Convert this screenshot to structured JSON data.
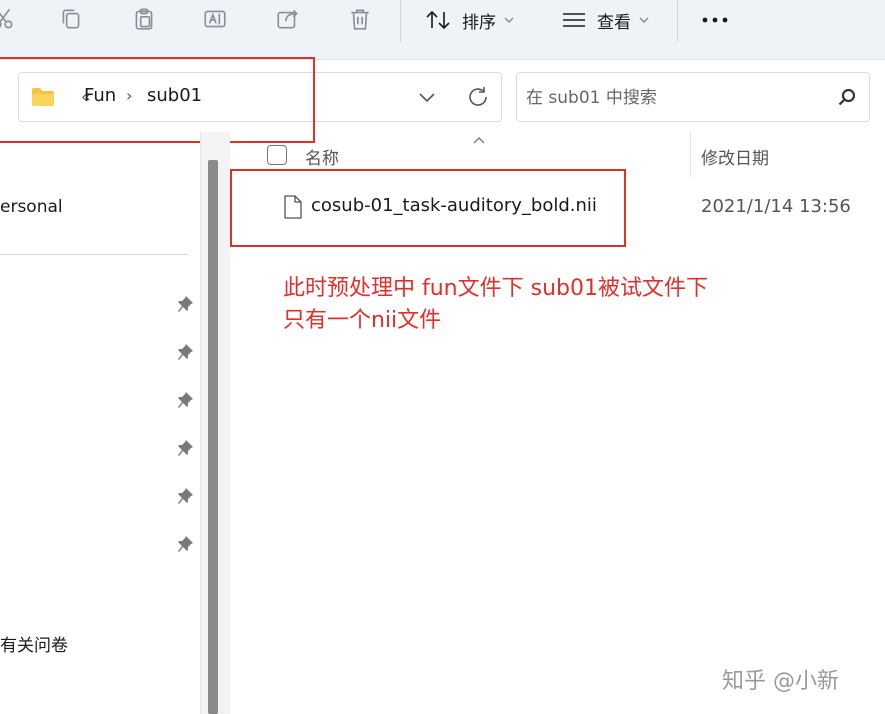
{
  "toolbar": {
    "sort_label": "排序",
    "view_label": "查看"
  },
  "address": {
    "overflow": "«",
    "crumbs": [
      "Fun",
      "sub01"
    ]
  },
  "search": {
    "placeholder": "在 sub01 中搜索"
  },
  "nav": {
    "personal_label": "ersonal",
    "survey_label": "有关问卷"
  },
  "file_list": {
    "columns": {
      "name": "名称",
      "date_modified": "修改日期"
    },
    "files": [
      {
        "name": "cosub-01_task-auditory_bold.nii",
        "date_modified": "2021/1/14 13:56"
      }
    ]
  },
  "annotation": {
    "line1": "此时预处理中 fun文件下 sub01被试文件下",
    "line2": "只有一个nii文件"
  },
  "watermark": "知乎 @小新",
  "colors": {
    "annotation_red": "#e0302b",
    "folder_yellow": "#f5c242",
    "toolbar_bg": "#eef3f8"
  }
}
